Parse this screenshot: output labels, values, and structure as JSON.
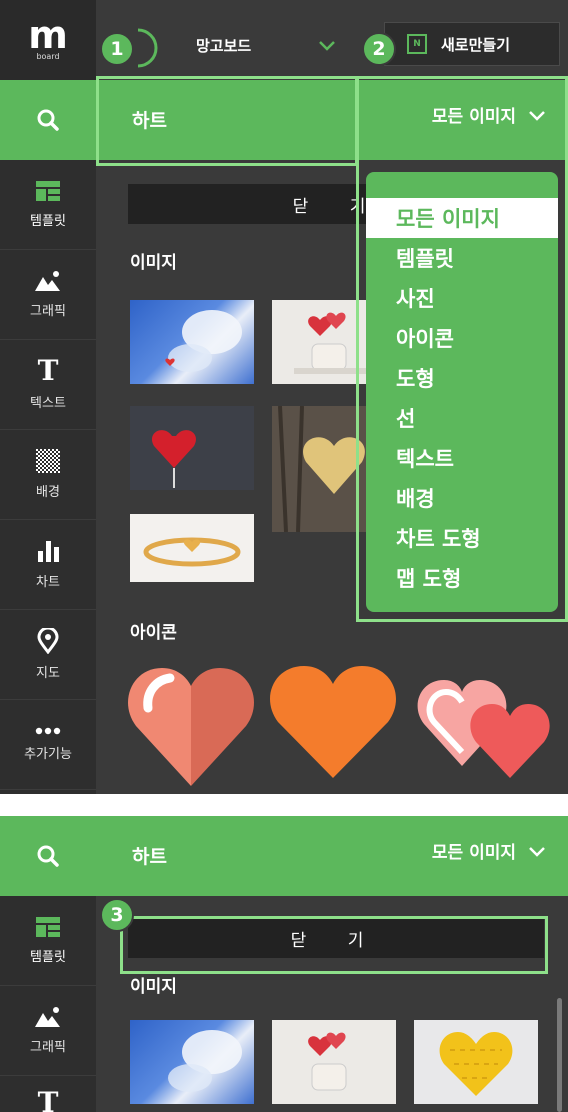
{
  "app": {
    "logo_text": "m",
    "logo_sub": "board",
    "board_name": "망고보드",
    "new_button_label": "새로만들기",
    "new_icon_letter": "N"
  },
  "badges": [
    "1",
    "2",
    "3"
  ],
  "search": {
    "query": "하트",
    "filter_label": "모든 이미지"
  },
  "sidebar": {
    "items": [
      {
        "label": "템플릿",
        "icon": "template-icon"
      },
      {
        "label": "그래픽",
        "icon": "graphic-icon"
      },
      {
        "label": "텍스트",
        "icon": "text-icon"
      },
      {
        "label": "배경",
        "icon": "background-icon"
      },
      {
        "label": "차트",
        "icon": "chart-icon"
      },
      {
        "label": "지도",
        "icon": "map-pin-icon"
      },
      {
        "label": "추가기능",
        "icon": "more-icon"
      }
    ]
  },
  "content": {
    "close_label": "닫 기",
    "images_title": "이미지",
    "icons_title": "아이콘"
  },
  "dropdown": {
    "options": [
      "모든 이미지",
      "템플릿",
      "사진",
      "아이콘",
      "도형",
      "선",
      "텍스트",
      "배경",
      "차트 도형",
      "맵 도형"
    ],
    "selected": "모든 이미지"
  },
  "colors": {
    "accent": "#5cb85c",
    "highlight": "#8ee08a",
    "panel": "#3a3a3a",
    "sidebar": "#2e2e2e"
  }
}
